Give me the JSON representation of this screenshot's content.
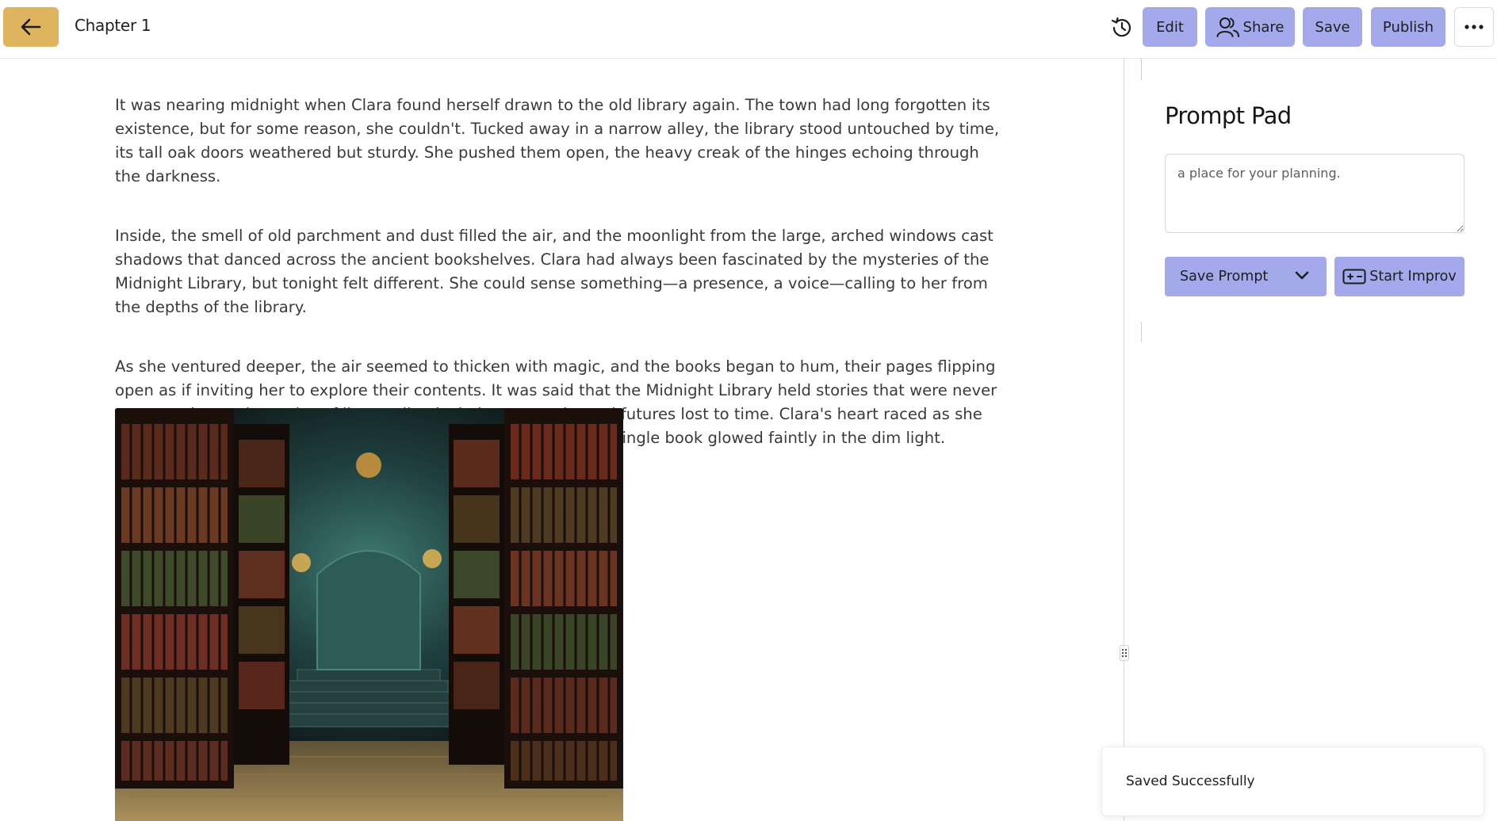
{
  "header": {
    "back_icon": "arrow-left-icon",
    "chapter_title": "Chapter 1",
    "history_icon": "history-icon",
    "edit_label": "Edit",
    "share_label": "Share",
    "share_icon": "users-icon",
    "save_label": "Save",
    "publish_label": "Publish",
    "more_icon": "more-horizontal-icon"
  },
  "story": {
    "paragraphs": [
      "It was nearing midnight when Clara found herself drawn to the old library again. The town had long forgotten its existence, but for some reason, she couldn't. Tucked away in a narrow alley, the library stood untouched by time, its tall oak doors weathered but sturdy. She pushed them open, the heavy creak of the hinges echoing through the darkness.",
      "Inside, the smell of old parchment and dust filled the air, and the moonlight from the large, arched windows cast shadows that danced across the ancient bookshelves. Clara had always been fascinated by the mysteries of the Midnight Library, but tonight felt different. She could sense something—a presence, a voice—calling to her from the depths of the library.",
      "As she ventured deeper, the air seemed to thicken with magic, and the books began to hum, their pages flipping open as if inviting her to explore their contents. It was said that the Midnight Library held stories that were never meant to be read—stories of lives unlived, choices unmade, and futures lost to time. Clara's heart raced as she approached a towering shelf in the center of the room, where a single book glowed faintly in the dim light."
    ]
  },
  "prompt_pad": {
    "title": "Prompt Pad",
    "placeholder": "a place for your planning.",
    "save_prompt_label": "Save Prompt",
    "start_improv_label": "Start Improv",
    "start_improv_icon": "gamepad-icon"
  },
  "toast": {
    "message": "Saved Successfully"
  },
  "colors": {
    "accent_gold": "#dfb45f",
    "button_lavender": "#a4a9ec"
  }
}
